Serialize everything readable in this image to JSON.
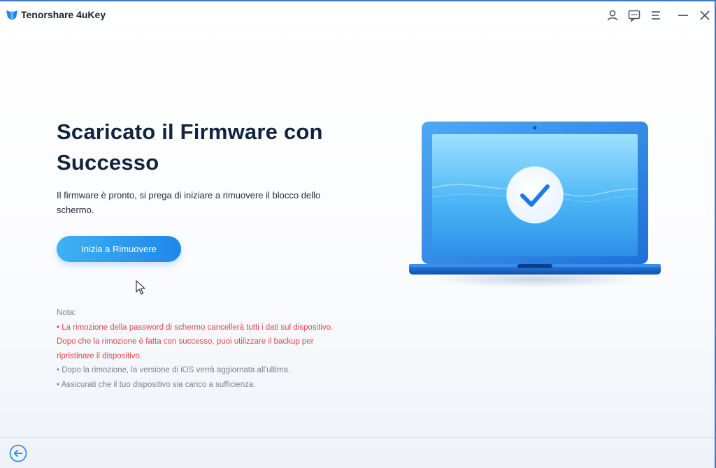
{
  "app": {
    "title": "Tenorshare 4uKey"
  },
  "titlebar": {
    "icons": [
      "user-icon",
      "feedback-icon",
      "menu-icon",
      "minimize-icon",
      "close-icon"
    ]
  },
  "main": {
    "heading_line1": "Scaricato il Firmware con",
    "heading_line2": "Successo",
    "subtitle_line1": "Il firmware è pronto, si prega di iniziare a rimuovere il blocco dello",
    "subtitle_line2": "schermo.",
    "start_button_label": "Inizia a Rimuovere"
  },
  "notes": {
    "label": "Nota:",
    "warning_line1": "• La rimozione della password di schermo cancellerà tutti i dati sul dispositivo.",
    "warning_line2": "Dopo che la rimozione è fatta con successo, puoi utilizzare il backup per",
    "warning_line3": "ripristinare il dispositivo.",
    "item2": "• Dopo la rimozione, la versione di iOS verrà aggiornata all'ultima.",
    "item3": "• Assicurati che il tuo dispositivo sia carico a sufficienza."
  },
  "illustration": {
    "icon": "laptop-success-checkmark-icon"
  },
  "footer": {
    "back_icon": "back-arrow-icon"
  },
  "colors": {
    "accent": "#1e87ea",
    "button_start": "#3fb1f4",
    "warning": "#e2454a",
    "heading": "#12233d",
    "muted": "#7a8494"
  }
}
